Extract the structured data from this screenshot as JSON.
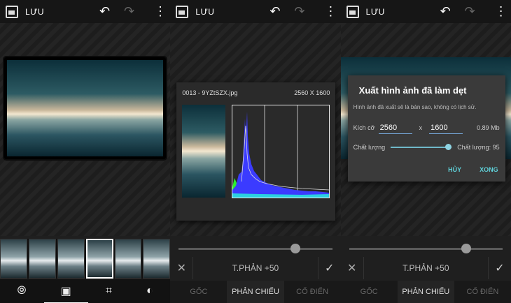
{
  "topbar": {
    "save_label": "LƯU"
  },
  "filmstrip": {
    "thumb_count": 5,
    "selected_index": 3
  },
  "bottom_tools": {
    "icons": [
      "looks-icon",
      "frame-icon",
      "crop-icon",
      "tone-icon"
    ]
  },
  "adjust": {
    "label": "T.PHẢN +50",
    "slider_value": 50
  },
  "tabs": {
    "items": [
      "GỐC",
      "PHẢN CHIẾU",
      "CỔ ĐIỂN"
    ],
    "selected": "PHẢN CHIẾU"
  },
  "image_info": {
    "filename": "0013 - 9YZtSZX.jpg",
    "dimensions": "2560 X 1600"
  },
  "export_dialog": {
    "title": "Xuất hình ảnh đã làm dẹt",
    "description": "Hình ảnh đã xuất sẽ là bản sao, không có lịch sử.",
    "size_label": "Kích cỡ",
    "width": "2560",
    "times": "x",
    "height": "1600",
    "file_size": "0.89 Mb",
    "quality_label": "Chất lượng",
    "quality_value_label": "Chất lượng: 95",
    "quality_value": 95,
    "cancel_label": "HỦY",
    "done_label": "XONG"
  },
  "colors": {
    "accent": "#5fd0d8",
    "histogram_blue": "#3b3bff",
    "histogram_green": "#2cf02c"
  }
}
